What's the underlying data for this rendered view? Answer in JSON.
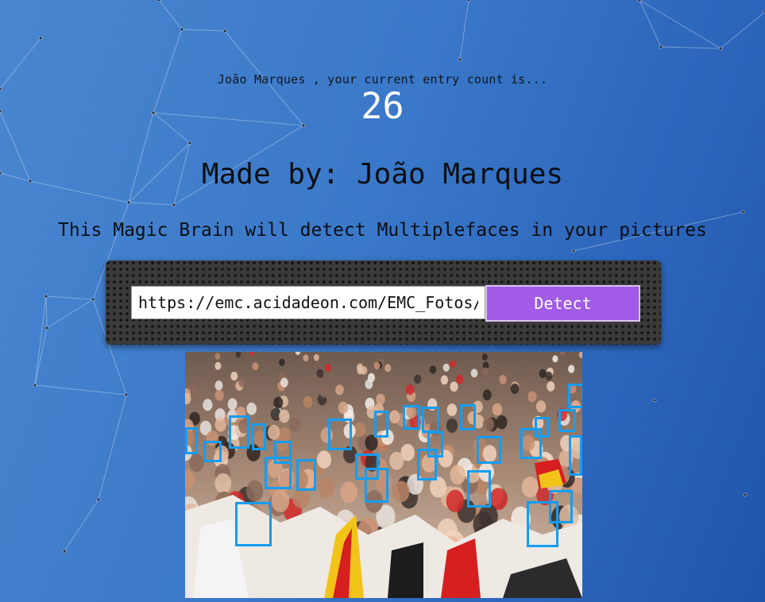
{
  "app": {
    "greeting": "João Marques , your current entry count is...",
    "entry_count": "26",
    "made_by": "Made by: João Marques",
    "tagline": "This Magic Brain will detect Multiplefaces in your pictures"
  },
  "form": {
    "url_value": "https://emc.acidadeon.com/EMC_Fotos/",
    "detect_label": "Detect"
  },
  "result": {
    "image": "crowd of football fans with detected faces",
    "faces_detected_count": 30,
    "box_color": "#149df2"
  },
  "colors": {
    "background": "#3a78c9",
    "button": "#a25be6",
    "panel": "#3a3a3a"
  }
}
